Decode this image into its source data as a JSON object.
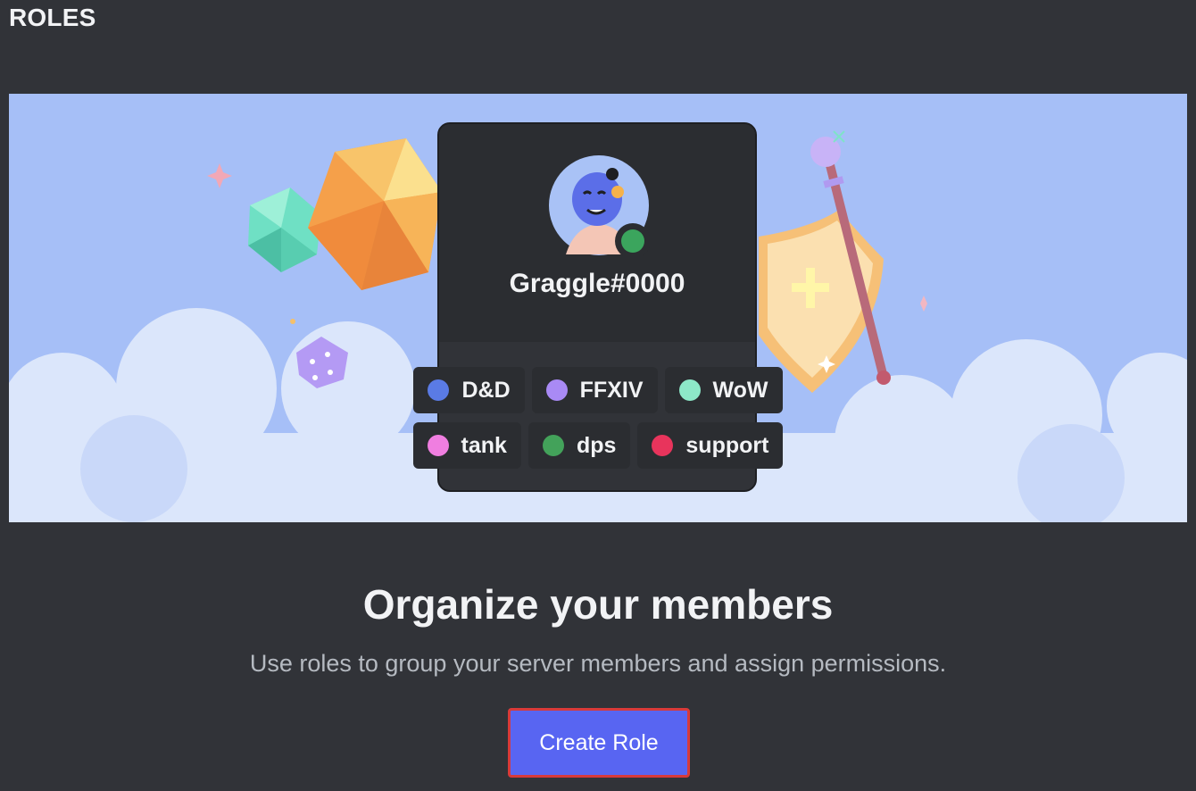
{
  "page": {
    "title": "ROLES"
  },
  "banner": {
    "username": "Graggle#0000",
    "roles": [
      [
        {
          "name": "D&D",
          "color": "#5a7be5"
        },
        {
          "name": "FFXIV",
          "color": "#a98af5"
        },
        {
          "name": "WoW",
          "color": "#8de8c8"
        }
      ],
      [
        {
          "name": "tank",
          "color": "#f07ee0"
        },
        {
          "name": "dps",
          "color": "#43a25a"
        },
        {
          "name": "support",
          "color": "#e8345c"
        }
      ]
    ]
  },
  "empty_state": {
    "heading": "Organize your members",
    "description": "Use roles to group your server members and assign permissions.",
    "button_label": "Create Role"
  },
  "colors": {
    "background": "#313338",
    "accent": "#5865f2",
    "banner_sky": "#a6bff7",
    "online_status": "#3ba55d"
  }
}
